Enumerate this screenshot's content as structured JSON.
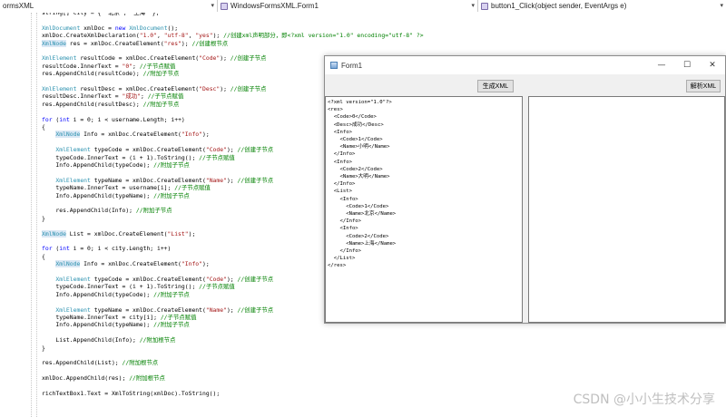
{
  "navbar": {
    "project": "ormsXML",
    "class": "WindowsFormsXML.Form1",
    "member": "button1_Click(object sender, EventArgs e)"
  },
  "code": [
    [
      [
        "",
        "string[] city = { \"北京\", \"上海\" };"
      ]
    ],
    [],
    [
      [
        "ty",
        "XmlDocument"
      ],
      [
        "",
        " xmlDoc = "
      ],
      [
        "kw",
        "new"
      ],
      [
        "",
        " "
      ],
      [
        "ty",
        "XmlDocument"
      ],
      [
        "",
        "();"
      ]
    ],
    [
      [
        "",
        "xmlDoc.CreateXmlDeclaration("
      ],
      [
        "str",
        "\"1.0\""
      ],
      [
        "",
        ", "
      ],
      [
        "str",
        "\"utf-8\""
      ],
      [
        "",
        ", "
      ],
      [
        "str",
        "\"yes\""
      ],
      [
        "",
        "); "
      ],
      [
        "cm",
        "//创建xml声明部分，即<?xml version=\"1.0\" encoding=\"utf-8\" ?>"
      ]
    ],
    [
      [
        "hl",
        "XmlNode"
      ],
      [
        "",
        " res = xmlDoc.CreateElement("
      ],
      [
        "str",
        "\"res\""
      ],
      [
        "",
        "); "
      ],
      [
        "cm",
        "//创建根节点"
      ]
    ],
    [],
    [
      [
        "ty",
        "XmlElement"
      ],
      [
        "",
        " resultCode = xmlDoc.CreateElement("
      ],
      [
        "str",
        "\"Code\""
      ],
      [
        "",
        "); "
      ],
      [
        "cm",
        "//创建子节点"
      ]
    ],
    [
      [
        "",
        "resultCode.InnerText = "
      ],
      [
        "str",
        "\"0\""
      ],
      [
        "",
        "; "
      ],
      [
        "cm",
        "//子节点赋值"
      ]
    ],
    [
      [
        "",
        "res.AppendChild(resultCode); "
      ],
      [
        "cm",
        "//附加子节点"
      ]
    ],
    [],
    [
      [
        "ty",
        "XmlElement"
      ],
      [
        "",
        " resultDesc = xmlDoc.CreateElement("
      ],
      [
        "str",
        "\"Desc\""
      ],
      [
        "",
        "); "
      ],
      [
        "cm",
        "//创建子节点"
      ]
    ],
    [
      [
        "",
        "resultDesc.InnerText = "
      ],
      [
        "str",
        "\"成功\""
      ],
      [
        "",
        "; "
      ],
      [
        "cm",
        "//子节点赋值"
      ]
    ],
    [
      [
        "",
        "res.AppendChild(resultDesc); "
      ],
      [
        "cm",
        "//附加子节点"
      ]
    ],
    [],
    [
      [
        "kw",
        "for"
      ],
      [
        "",
        " ("
      ],
      [
        "kw",
        "int"
      ],
      [
        "",
        " i = 0; i < username.Length; i++)"
      ]
    ],
    [
      [
        "",
        "{"
      ]
    ],
    [
      [
        "",
        "    "
      ],
      [
        "hl",
        "XmlNode"
      ],
      [
        "",
        " Info = xmlDoc.CreateElement("
      ],
      [
        "str",
        "\"Info\""
      ],
      [
        "",
        ");"
      ]
    ],
    [],
    [
      [
        "",
        "    "
      ],
      [
        "ty",
        "XmlElement"
      ],
      [
        "",
        " typeCode = xmlDoc.CreateElement("
      ],
      [
        "str",
        "\"Code\""
      ],
      [
        "",
        "); "
      ],
      [
        "cm",
        "//创建子节点"
      ]
    ],
    [
      [
        "",
        "    typeCode.InnerText = (i + 1).ToString(); "
      ],
      [
        "cm",
        "//子节点赋值"
      ]
    ],
    [
      [
        "",
        "    Info.AppendChild(typeCode); "
      ],
      [
        "cm",
        "//附加子节点"
      ]
    ],
    [],
    [
      [
        "",
        "    "
      ],
      [
        "ty",
        "XmlElement"
      ],
      [
        "",
        " typeName = xmlDoc.CreateElement("
      ],
      [
        "str",
        "\"Name\""
      ],
      [
        "",
        "); "
      ],
      [
        "cm",
        "//创建子节点"
      ]
    ],
    [
      [
        "",
        "    typeName.InnerText = username[i]; "
      ],
      [
        "cm",
        "//子节点赋值"
      ]
    ],
    [
      [
        "",
        "    Info.AppendChild(typeName); "
      ],
      [
        "cm",
        "//附加子节点"
      ]
    ],
    [],
    [
      [
        "",
        "    res.AppendChild(Info); "
      ],
      [
        "cm",
        "//附加子节点"
      ]
    ],
    [
      [
        "",
        "}"
      ]
    ],
    [],
    [
      [
        "hl",
        "XmlNode"
      ],
      [
        "",
        " List = xmlDoc.CreateElement("
      ],
      [
        "str",
        "\"List\""
      ],
      [
        "",
        ");"
      ]
    ],
    [],
    [
      [
        "kw",
        "for"
      ],
      [
        "",
        " ("
      ],
      [
        "kw",
        "int"
      ],
      [
        "",
        " i = 0; i < city.Length; i++)"
      ]
    ],
    [
      [
        "",
        "{"
      ]
    ],
    [
      [
        "",
        "    "
      ],
      [
        "hl",
        "XmlNode"
      ],
      [
        "",
        " Info = xmlDoc.CreateElement("
      ],
      [
        "str",
        "\"Info\""
      ],
      [
        "",
        ");"
      ]
    ],
    [],
    [
      [
        "",
        "    "
      ],
      [
        "ty",
        "XmlElement"
      ],
      [
        "",
        " typeCode = xmlDoc.CreateElement("
      ],
      [
        "str",
        "\"Code\""
      ],
      [
        "",
        "); "
      ],
      [
        "cm",
        "//创建子节点"
      ]
    ],
    [
      [
        "",
        "    typeCode.InnerText = (i + 1).ToString(); "
      ],
      [
        "cm",
        "//子节点赋值"
      ]
    ],
    [
      [
        "",
        "    Info.AppendChild(typeCode); "
      ],
      [
        "cm",
        "//附加子节点"
      ]
    ],
    [],
    [
      [
        "",
        "    "
      ],
      [
        "ty",
        "XmlElement"
      ],
      [
        "",
        " typeName = xmlDoc.CreateElement("
      ],
      [
        "str",
        "\"Name\""
      ],
      [
        "",
        "); "
      ],
      [
        "cm",
        "//创建子节点"
      ]
    ],
    [
      [
        "",
        "    typeName.InnerText = city[i]; "
      ],
      [
        "cm",
        "//子节点赋值"
      ]
    ],
    [
      [
        "",
        "    Info.AppendChild(typeName); "
      ],
      [
        "cm",
        "//附加子节点"
      ]
    ],
    [],
    [
      [
        "",
        "    List.AppendChild(Info); "
      ],
      [
        "cm",
        "//附加根节点"
      ]
    ],
    [
      [
        "",
        "}"
      ]
    ],
    [],
    [
      [
        "",
        "res.AppendChild(List); "
      ],
      [
        "cm",
        "//附加根节点"
      ]
    ],
    [],
    [
      [
        "",
        "xmlDoc.AppendChild(res); "
      ],
      [
        "cm",
        "//附加根节点"
      ]
    ],
    [],
    [
      [
        "",
        "richTextBox1.Text = XmlToString(xmlDoc).ToString();"
      ]
    ]
  ],
  "form": {
    "title": "Form1",
    "minimize": "—",
    "maximize": "☐",
    "close": "✕",
    "generate_button": "生成XML",
    "parse_button": "解析XML",
    "xml_lines": [
      "<?xml version=\"1.0\"?>",
      "<res>",
      "  <Code>0</Code>",
      "  <Desc>成功</Desc>",
      "  <Info>",
      "    <Code>1</Code>",
      "    <Name>小明</Name>",
      "  </Info>",
      "  <Info>",
      "    <Code>2</Code>",
      "    <Name>大明</Name>",
      "  </Info>",
      "  <List>",
      "    <Info>",
      "      <Code>1</Code>",
      "      <Name>北京</Name>",
      "    </Info>",
      "    <Info>",
      "      <Code>2</Code>",
      "      <Name>上海</Name>",
      "    </Info>",
      "  </List>",
      "</res>"
    ]
  },
  "watermark": "CSDN @小小生技术分享"
}
